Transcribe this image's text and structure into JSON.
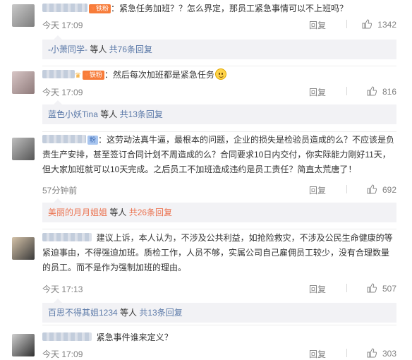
{
  "comments": [
    {
      "badge": "铁粉",
      "text": "：紧急任务加班？？怎么界定，那员工紧急事情可以不上班吗？",
      "time": "今天 17:09",
      "reply_label": "回复",
      "likes": "1342",
      "subreply": {
        "user": "-小萧同学-",
        "suffix": " 等人 ",
        "count": "共76条回复"
      }
    },
    {
      "badge": "铁粉",
      "text": "：然后每次加班都是紧急任务",
      "time": "今天 17:09",
      "reply_label": "回复",
      "likes": "816",
      "subreply": {
        "user": "蓝色小妖Tina",
        "suffix": " 等人 ",
        "count": "共13条回复"
      }
    },
    {
      "badge": "粉",
      "text": "：这劳动法真牛逼，最根本的问题，企业的损失是检验员造成的么？不应该是负责生产安排，甚至签订合同计划不周造成的么？合同要求10日内交付，你实际能力刚好11天，但大家加班就可以10天完成。之后员工不加班造成违约是员工责任？简直太荒唐了！",
      "time": "57分钟前",
      "reply_label": "回复",
      "likes": "692",
      "subreply": {
        "user": "美丽的月月姐姐",
        "suffix": " 等人 ",
        "count": "共26条回复"
      }
    },
    {
      "text": "建议上诉，本人认为，不涉及公共利益，如抢险救灾，不涉及公民生命健康的等紧迫事由，不得强迫加班。质检工作，人员不够，实属公司自己雇佣员工较少，没有合理数量的员工。而不是作为强制加班的理由。",
      "time": "今天 17:13",
      "reply_label": "回复",
      "likes": "507",
      "subreply": {
        "user": "百思不得其姐1234",
        "suffix": " 等人 ",
        "count": "共13条回复"
      }
    },
    {
      "text": "紧急事件谁来定义？",
      "time": "今天 17:09",
      "reply_label": "回复",
      "likes": "303"
    }
  ]
}
